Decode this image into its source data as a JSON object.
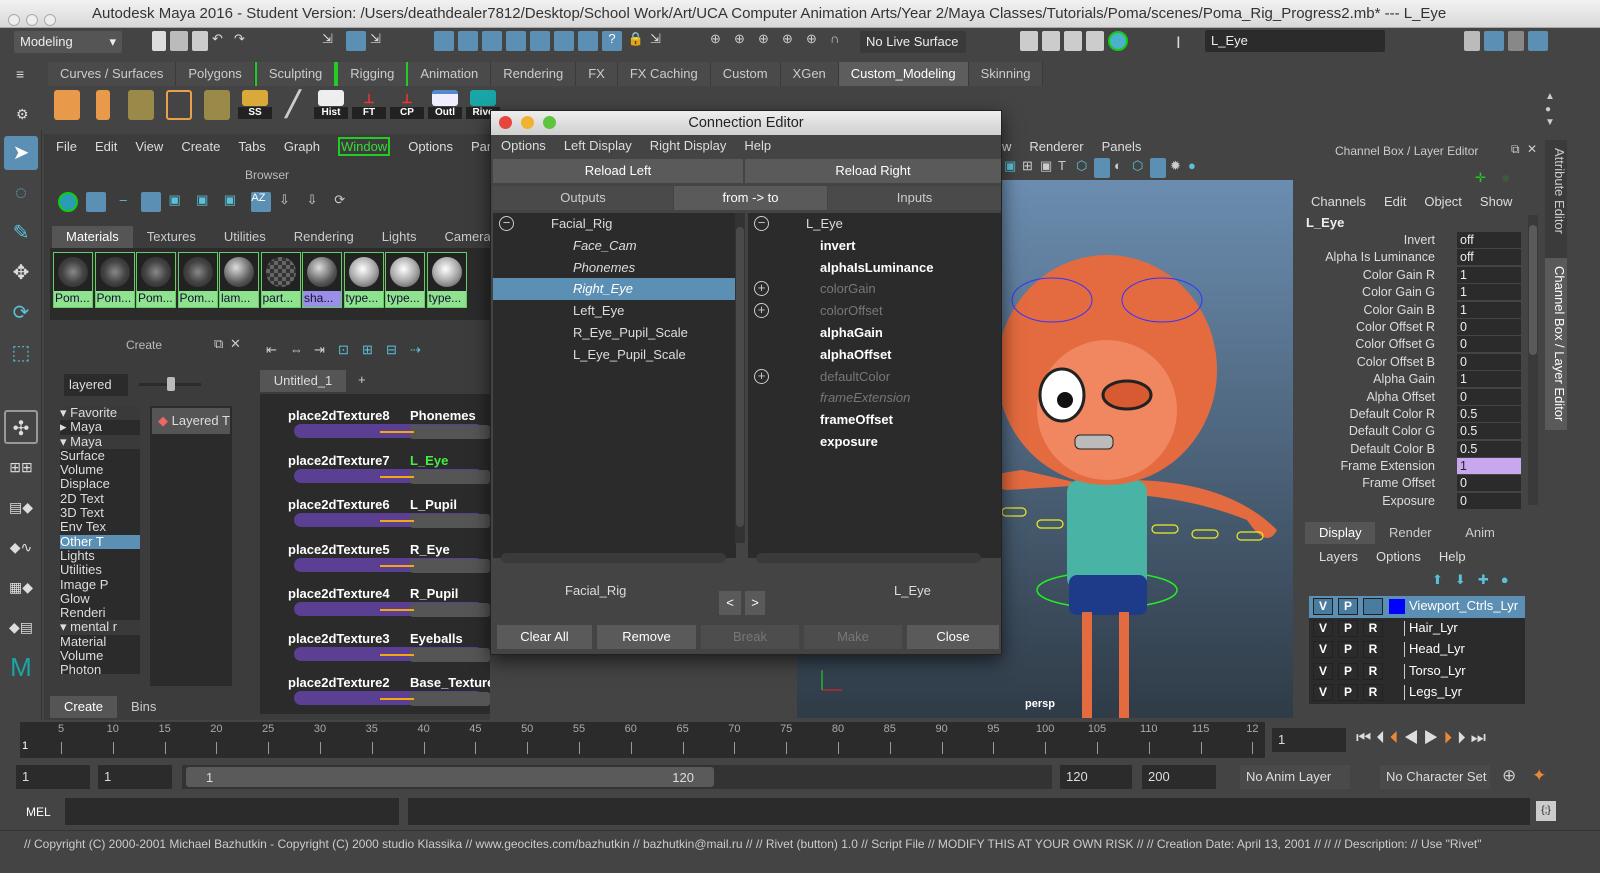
{
  "window": {
    "title": "Autodesk Maya 2016 - Student Version: /Users/deathdealer7812/Desktop/School Work/Art/UCA Computer Animation Arts/Year 2/Maya Classes/Tutorials/Poma/scenes/Poma_Rig_Progress2.mb*  ---  L_Eye"
  },
  "statusline": {
    "menuset": "Modeling",
    "live_surface": "No Live Surface",
    "selection_field": "L_Eye"
  },
  "shelf": {
    "tabs": [
      "Curves / Surfaces",
      "Polygons",
      "Sculpting",
      "Rigging",
      "Animation",
      "Rendering",
      "FX",
      "FX Caching",
      "Custom",
      "XGen",
      "Custom_Modeling",
      "Skinning"
    ],
    "active_tab": "Custom_Modeling",
    "buttons": [
      "SS",
      "Hist",
      "FT",
      "CP",
      "Outl",
      "Rive"
    ]
  },
  "hypershade": {
    "menu": [
      "File",
      "Edit",
      "View",
      "Create",
      "Tabs",
      "Graph",
      "Window",
      "Options",
      "Panels"
    ],
    "browser_label": "Browser",
    "tabs": [
      "Materials",
      "Textures",
      "Utilities",
      "Rendering",
      "Lights",
      "Cameras"
    ],
    "swatches": [
      "Pom...",
      "Pom...",
      "Pom...",
      "Pom...",
      "lam...",
      "part...",
      "sha...",
      "type...",
      "type...",
      "type..."
    ],
    "create_label": "Create",
    "create_filter": "layered",
    "tree": [
      "Favorite",
      "Maya",
      "Maya",
      "Surface",
      "Volume",
      "Displace",
      "2D Text",
      "3D Text",
      "Env Tex",
      "Other T",
      "Lights",
      "Utilities",
      "Image P",
      "Glow",
      "Renderi",
      "mental r",
      "Material",
      "Volume",
      "Photon"
    ],
    "create_result": "Layered T",
    "bottom_tabs": [
      "Create",
      "Bins"
    ],
    "graph_tab": "Untitled_1",
    "graph_add": "+",
    "nodes": [
      {
        "place": "place2dTexture8",
        "tex": "Phonemes"
      },
      {
        "place": "place2dTexture7",
        "tex": "L_Eye"
      },
      {
        "place": "place2dTexture6",
        "tex": "L_Pupil"
      },
      {
        "place": "place2dTexture5",
        "tex": "R_Eye"
      },
      {
        "place": "place2dTexture4",
        "tex": "R_Pupil"
      },
      {
        "place": "place2dTexture3",
        "tex": "Eyeballs"
      },
      {
        "place": "place2dTexture2",
        "tex": "Base_Texture"
      }
    ]
  },
  "connection_editor": {
    "title": "Connection Editor",
    "menu": [
      "Options",
      "Left Display",
      "Right Display",
      "Help"
    ],
    "reload_left": "Reload Left",
    "reload_right": "Reload Right",
    "outputs": "Outputs",
    "direction": "from -> to",
    "inputs": "Inputs",
    "left_root": "Facial_Rig",
    "left_items": [
      "Face_Cam",
      "Phonemes",
      "Right_Eye",
      "Left_Eye",
      "R_Eye_Pupil_Scale",
      "L_Eye_Pupil_Scale"
    ],
    "right_root": "L_Eye",
    "right_items": [
      "invert",
      "alphaIsLuminance",
      "colorGain",
      "colorOffset",
      "alphaGain",
      "alphaOffset",
      "defaultColor",
      "frameExtension",
      "frameOffset",
      "exposure"
    ],
    "left_node": "Facial_Rig",
    "right_node": "L_Eye",
    "prev": "<",
    "next": ">",
    "buttons": {
      "clear_all": "Clear All",
      "remove": "Remove",
      "break": "Break",
      "make": "Make",
      "close": "Close"
    }
  },
  "viewport": {
    "menu": [
      "w",
      "Renderer",
      "Panels"
    ],
    "camera": "persp"
  },
  "channel_box": {
    "title": "Channel Box / Layer Editor",
    "menu": [
      "Channels",
      "Edit",
      "Object",
      "Show"
    ],
    "node": "L_Eye",
    "attrs": [
      [
        "Invert",
        "off"
      ],
      [
        "Alpha Is Luminance",
        "off"
      ],
      [
        "Color Gain R",
        "1"
      ],
      [
        "Color Gain G",
        "1"
      ],
      [
        "Color Gain B",
        "1"
      ],
      [
        "Color Offset R",
        "0"
      ],
      [
        "Color Offset G",
        "0"
      ],
      [
        "Color Offset B",
        "0"
      ],
      [
        "Alpha Gain",
        "1"
      ],
      [
        "Alpha Offset",
        "0"
      ],
      [
        "Default Color R",
        "0.5"
      ],
      [
        "Default Color G",
        "0.5"
      ],
      [
        "Default Color B",
        "0.5"
      ],
      [
        "Frame Extension",
        "1"
      ],
      [
        "Frame Offset",
        "0"
      ],
      [
        "Exposure",
        "0"
      ]
    ],
    "layer_tabs": [
      "Display",
      "Render",
      "Anim"
    ],
    "layer_menu": [
      "Layers",
      "Options",
      "Help"
    ],
    "layers": [
      "Viewport_Ctrls_Lyr",
      "Hair_Lyr",
      "Head_Lyr",
      "Torso_Lyr",
      "Legs_Lyr"
    ],
    "vpr": [
      "V",
      "P",
      "R"
    ],
    "side_tabs": [
      "Attribute Editor",
      "Channel Box / Layer Editor"
    ]
  },
  "timeline": {
    "ticks": [
      "5",
      "10",
      "15",
      "20",
      "25",
      "30",
      "35",
      "40",
      "45",
      "50",
      "55",
      "60",
      "65",
      "70",
      "75",
      "80",
      "85",
      "90",
      "95",
      "100",
      "105",
      "110",
      "115",
      "12"
    ],
    "start_marker": "1",
    "current_frame": "1"
  },
  "range": {
    "start": "1",
    "playback_start": "1",
    "slider_start": "1",
    "slider_end": "120",
    "playback_end": "120",
    "end": "200",
    "anim_layer": "No Anim Layer",
    "character_set": "No Character Set"
  },
  "command": {
    "label": "MEL"
  },
  "helpline": "// Copyright (C) 2000-2001 Michael Bazhutkin - Copyright (C) 2000 studio Klassika // www.geocites.com/bazhutkin // bazhutkin@mail.ru // //  Rivet (button) 1.0 //  Script File //  MODIFY THIS AT YOUR OWN RISK // //  Creation Date:  April 13, 2001 // // //  Description: // Use \"Rivet\"",
  "colors": {
    "accent": "#5b8fb3",
    "swatch_green": "#8fe38f",
    "highlight": "#c9a7ef",
    "node_purple": "#5a3f93"
  }
}
